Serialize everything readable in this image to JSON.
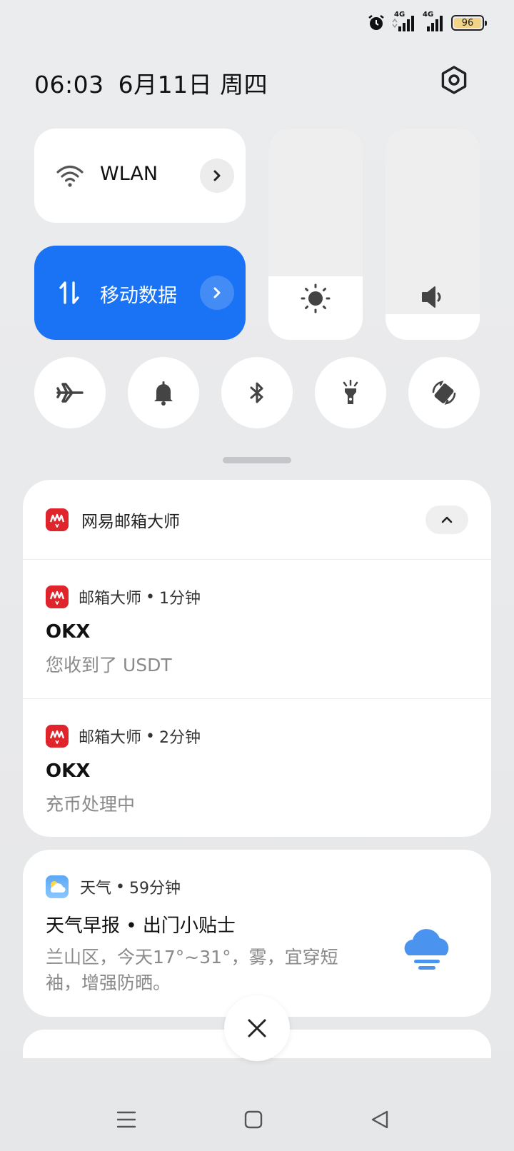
{
  "status_bar": {
    "battery_level": "96",
    "network_1": "4G",
    "network_2": "4G"
  },
  "header": {
    "time": "06:03",
    "date": "6月11日 周四"
  },
  "quick_tiles": {
    "wlan_label": "WLAN",
    "mobile_data_label": "移动数据",
    "brightness_level": 0.3,
    "volume_level": 0.12
  },
  "notifications": {
    "group": {
      "app_name": "网易邮箱大师",
      "items": [
        {
          "app": "邮箱大师",
          "time": "1分钟",
          "title": "OKX",
          "body": "您收到了 USDT"
        },
        {
          "app": "邮箱大师",
          "time": "2分钟",
          "title": "OKX",
          "body": "充币处理中"
        }
      ]
    },
    "weather": {
      "app": "天气",
      "time": "59分钟",
      "title": "天气早报 • 出门小贴士",
      "body": "兰山区，今天17°~31°，雾，宜穿短袖，增强防晒。"
    }
  },
  "colors": {
    "accent": "#1a73f5",
    "mail_brand": "#e0242b"
  }
}
